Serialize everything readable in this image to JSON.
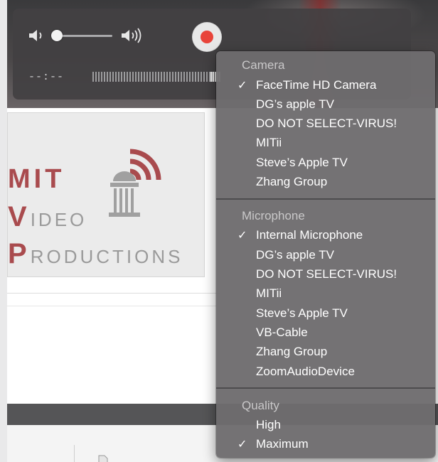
{
  "controls": {
    "elapsed_time": "--:--"
  },
  "logo": {
    "line1": "MIT",
    "line2_initial": "V",
    "line2_rest": "IDEO",
    "line3_initial": "P",
    "line3_rest": "RODUCTIONS"
  },
  "menu": {
    "camera": {
      "header": "Camera",
      "items": [
        {
          "label": "FaceTime HD Camera",
          "checked": true
        },
        {
          "label": "DG’s apple TV",
          "checked": false
        },
        {
          "label": "DO NOT SELECT-VIRUS!",
          "checked": false
        },
        {
          "label": "MITii",
          "checked": false
        },
        {
          "label": "Steve’s Apple TV",
          "checked": false
        },
        {
          "label": "Zhang Group",
          "checked": false
        }
      ]
    },
    "microphone": {
      "header": "Microphone",
      "items": [
        {
          "label": "Internal Microphone",
          "checked": true
        },
        {
          "label": "DG’s apple TV",
          "checked": false
        },
        {
          "label": "DO NOT SELECT-VIRUS!",
          "checked": false
        },
        {
          "label": "MITii",
          "checked": false
        },
        {
          "label": "Steve’s Apple TV",
          "checked": false
        },
        {
          "label": "VB-Cable",
          "checked": false
        },
        {
          "label": "Zhang Group",
          "checked": false
        },
        {
          "label": "ZoomAudioDevice",
          "checked": false
        }
      ]
    },
    "quality": {
      "header": "Quality",
      "items": [
        {
          "label": "High",
          "checked": false
        },
        {
          "label": "Maximum",
          "checked": true
        }
      ]
    },
    "check_glyph": "✓"
  },
  "colors": {
    "record": "#e8443a",
    "logo_red": "#a94b4e"
  },
  "icons": {
    "volume_low": "speaker-low-icon",
    "volume_high": "speaker-high-icon",
    "record": "record-icon",
    "logo": "dome-building-signal-icon"
  }
}
